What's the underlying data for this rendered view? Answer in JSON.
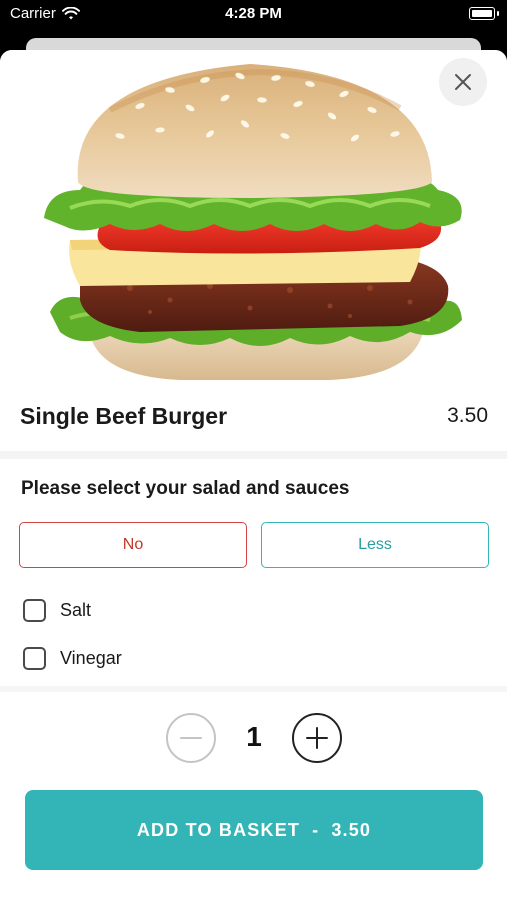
{
  "status_bar": {
    "carrier": "Carrier",
    "time": "4:28 PM"
  },
  "product": {
    "name": "Single Beef Burger",
    "price": "3.50",
    "image_icon": "burger-photo"
  },
  "options": {
    "title": "Please select your salad and sauces",
    "buttons": [
      {
        "label": "No",
        "color": "#d14545"
      },
      {
        "label": "Less",
        "color": "#35b5b5"
      }
    ],
    "checkboxes": [
      {
        "label": "Salt",
        "checked": false
      },
      {
        "label": "Vinegar",
        "checked": false
      }
    ]
  },
  "quantity": {
    "value": "1"
  },
  "cta": {
    "label": "ADD TO BASKET",
    "separator": "-",
    "price": "3.50",
    "color": "#33b4b6"
  },
  "icons": {
    "close": "close-icon",
    "minus": "minus-icon",
    "plus": "plus-icon",
    "wifi": "wifi-icon",
    "battery": "battery-icon"
  }
}
